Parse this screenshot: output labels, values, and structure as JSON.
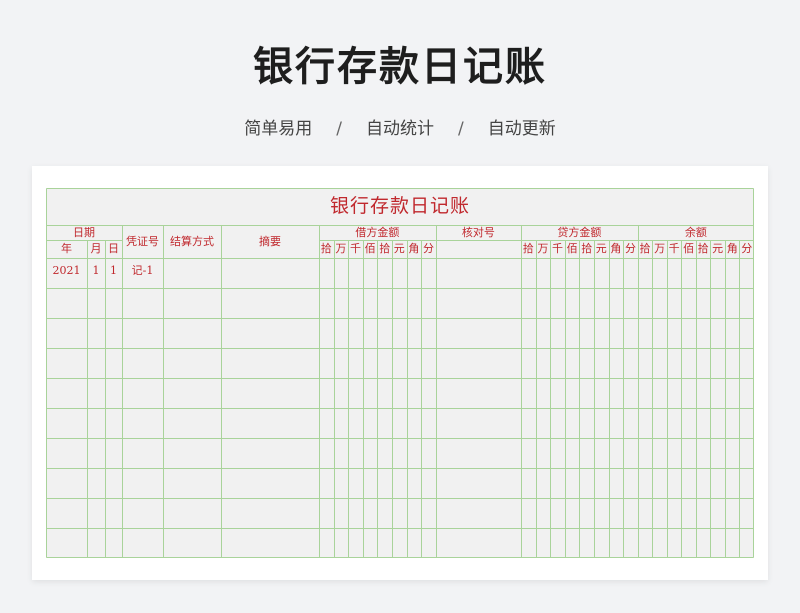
{
  "page": {
    "title": "银行存款日记账",
    "features": [
      "简单易用",
      "自动统计",
      "自动更新"
    ],
    "separator": "/"
  },
  "ledger": {
    "title": "银行存款日记账",
    "headers": {
      "date": "日期",
      "year": "年",
      "month": "月",
      "day": "日",
      "voucher": "凭证号",
      "settlement": "结算方式",
      "summary": "摘要",
      "debit": "借方金额",
      "check_no": "核对号",
      "credit": "贷方金额",
      "balance": "余额",
      "digits": [
        "拾",
        "万",
        "千",
        "佰",
        "拾",
        "元",
        "角",
        "分"
      ]
    },
    "rows": [
      {
        "year": "2021",
        "month": "1",
        "day": "1",
        "voucher": "记-1"
      }
    ],
    "empty_rows": 9
  },
  "colors": {
    "grid": "#a9d39a",
    "header_text": "#c0282d",
    "ledger_bg": "#f1f1f1"
  }
}
